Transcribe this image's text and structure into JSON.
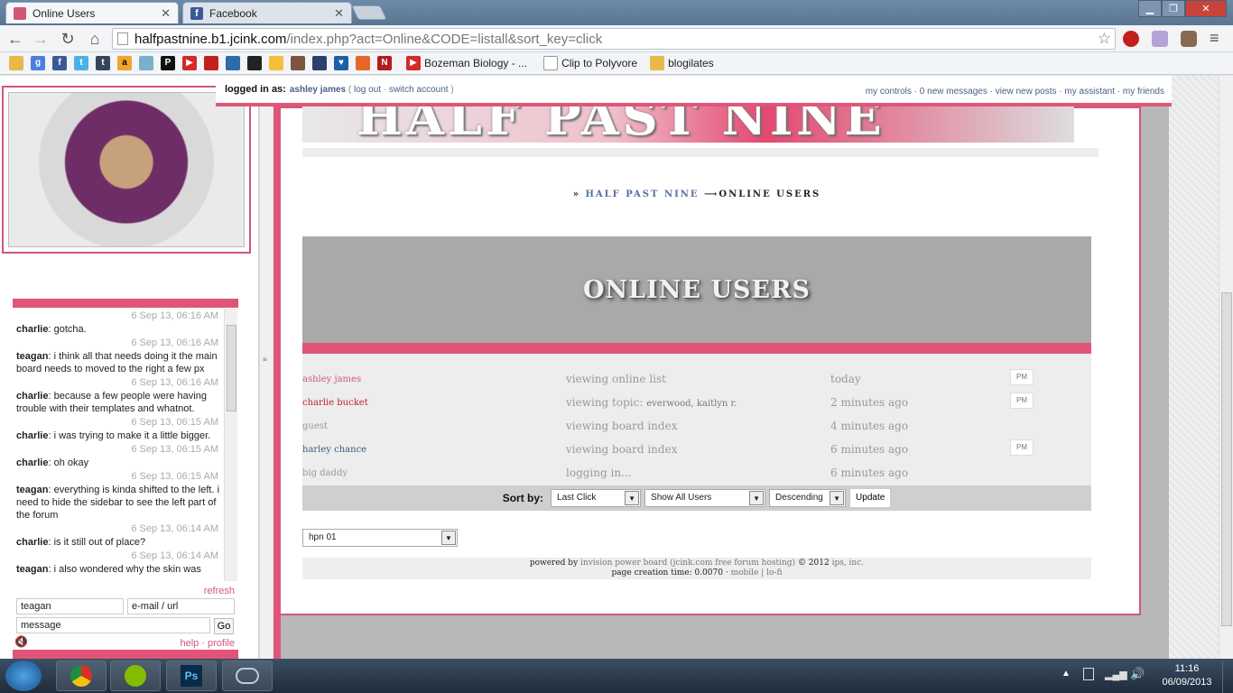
{
  "browser": {
    "tabs": [
      {
        "title": "Online Users",
        "favicon_color": "#d05877"
      },
      {
        "title": "Facebook",
        "favicon_color": "#3b5998"
      }
    ],
    "url_domain": "halfpastnine.b1.jcink.com",
    "url_path": "/index.php?act=Online&CODE=listall&sort_key=click",
    "bookmarks": [
      {
        "label": "Bozeman Biology - ...",
        "icon": "youtube-icon"
      },
      {
        "label": "Clip to Polyvore",
        "icon": "page-icon"
      },
      {
        "label": "blogilates",
        "icon": "folder-icon"
      }
    ]
  },
  "login": {
    "prefix": "logged in as:",
    "user": "ashley james",
    "open": "(",
    "logout": "log out",
    "sep": "·",
    "switch": "switch account",
    "close": ")",
    "links": "my controls · 0 new messages · view new posts · my assistant · my friends"
  },
  "forum": {
    "banner": "HALF PAST NINE",
    "breadcrumb_prefix": "»",
    "breadcrumb_home": "HALF PAST NINE",
    "breadcrumb_arrow": "⟶",
    "breadcrumb_current": "ONLINE USERS",
    "heading": "ONLINE USERS"
  },
  "online_users": [
    {
      "name": "ashley james",
      "name_color": "#d05877",
      "action": "viewing online list",
      "detail": "",
      "time": "today",
      "pm": "PM"
    },
    {
      "name": "charlie bucket",
      "name_color": "#c0202a",
      "action": "viewing topic:",
      "detail": "everwood, kaitlyn r.",
      "time": "2 minutes ago",
      "pm": "PM"
    },
    {
      "name": "guest",
      "name_color": "#999999",
      "action": "viewing board index",
      "detail": "",
      "time": "4 minutes ago",
      "pm": ""
    },
    {
      "name": "harley chance",
      "name_color": "#3d5a7a",
      "action": "viewing board index",
      "detail": "",
      "time": "6 minutes ago",
      "pm": "PM"
    },
    {
      "name": "big daddy",
      "name_color": "#999999",
      "action": "logging in...",
      "detail": "",
      "time": "6 minutes ago",
      "pm": ""
    }
  ],
  "sort": {
    "label": "Sort by:",
    "key": "Last Click",
    "filter": "Show All Users",
    "order": "Descending",
    "update": "Update"
  },
  "skin": "hpn 01",
  "footer": {
    "line1_a": "powered by",
    "line1_b": "invision power board (jcink.com free forum hosting)",
    "line1_c": "© 2012",
    "line1_d": "ips, inc.",
    "line2": "page creation time: 0.0070 ·",
    "line2_b": "mobile | lo-fi"
  },
  "chat": {
    "messages": [
      {
        "time": "6 Sep 13, 06:16 AM",
        "user": "charlie",
        "text": ": gotcha."
      },
      {
        "time": "6 Sep 13, 06:16 AM",
        "user": "teagan",
        "text": ": i think all that needs doing it the main board needs to moved to the right a few px"
      },
      {
        "time": "6 Sep 13, 06:16 AM",
        "user": "charlie",
        "text": ": because a few people were having trouble with their templates and whatnot."
      },
      {
        "time": "6 Sep 13, 06:15 AM",
        "user": "charlie",
        "text": ": i was trying to make it a little bigger."
      },
      {
        "time": "6 Sep 13, 06:15 AM",
        "user": "charlie",
        "text": ": oh okay"
      },
      {
        "time": "6 Sep 13, 06:15 AM",
        "user": "teagan",
        "text": ": everything is kinda shifted to the left. i need to hide the sidebar to see the left part of the forum"
      },
      {
        "time": "6 Sep 13, 06:14 AM",
        "user": "charlie",
        "text": ": is it still out of place?"
      },
      {
        "time": "6 Sep 13, 06:14 AM",
        "user": "teagan",
        "text": ": i also wondered why the skin was"
      }
    ],
    "refresh": "refresh",
    "name_value": "teagan",
    "email_placeholder": "e-mail / url",
    "message_placeholder": "message",
    "go": "Go",
    "help_links": "help · profile"
  },
  "taskbar": {
    "time": "11:16",
    "date": "06/09/2013"
  }
}
